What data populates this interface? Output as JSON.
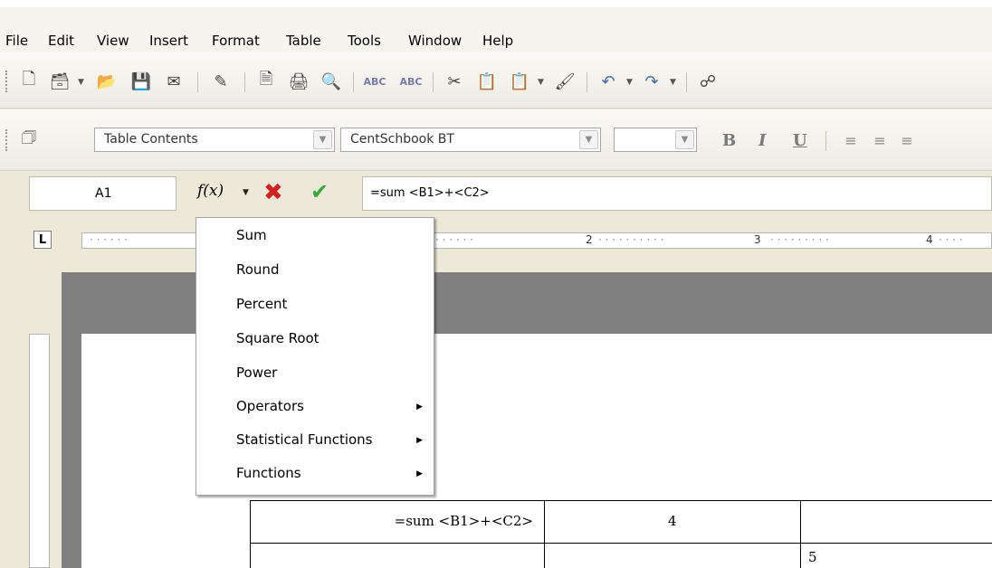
{
  "menubar": {
    "items": [
      {
        "label": "File"
      },
      {
        "label": "Edit"
      },
      {
        "label": "View"
      },
      {
        "label": "Insert"
      },
      {
        "label": "Format"
      },
      {
        "label": "Table"
      },
      {
        "label": "Tools"
      },
      {
        "label": "Window"
      },
      {
        "label": "Help"
      }
    ]
  },
  "format_toolbar": {
    "style": "Table Contents",
    "font": "CentSchbook BT",
    "size": "",
    "bold": "B",
    "italic": "I",
    "underline": "U"
  },
  "formula_bar": {
    "cell_ref": "A1",
    "fx_label": "f(x)",
    "formula": "=sum <B1>+<C2>"
  },
  "ruler": {
    "numbers": [
      "2",
      "3",
      "4"
    ]
  },
  "fx_menu": {
    "items": [
      {
        "label": "Sum",
        "submenu": false
      },
      {
        "label": "Round",
        "submenu": false
      },
      {
        "label": "Percent",
        "submenu": false
      },
      {
        "label": "Square Root",
        "submenu": false
      },
      {
        "label": "Power",
        "submenu": false
      },
      {
        "label": "Operators",
        "submenu": true
      },
      {
        "label": "Statistical Functions",
        "submenu": true
      },
      {
        "label": "Functions",
        "submenu": true
      }
    ]
  },
  "table": {
    "cells": {
      "a1": "=sum <B1>+<C2>",
      "b1": "4",
      "c2": "5"
    }
  }
}
